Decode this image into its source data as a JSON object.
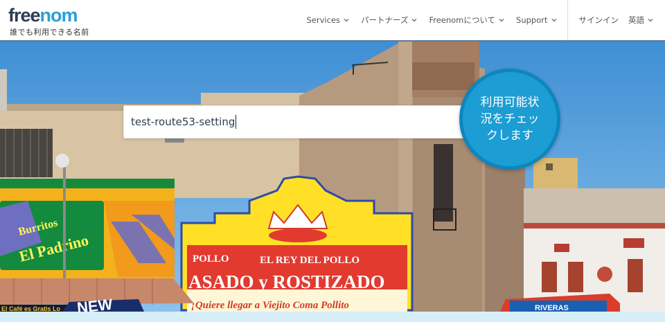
{
  "header": {
    "logo": {
      "word_part1": "free",
      "word_part2": "nom",
      "tagline": "誰でも利用できる名前"
    },
    "nav": {
      "services": "Services",
      "partners": "パートナーズ",
      "about": "Freenomについて",
      "support": "Support",
      "signin": "サインイン",
      "language": "英語"
    }
  },
  "hero": {
    "search": {
      "value": "test-route53-setting"
    },
    "check_button": "利用可能状況をチェックします",
    "signs": {
      "burritos": "Burritos",
      "el_padrino": "El Padrino",
      "pollo": "POLLO",
      "el_rey": "EL REY DEL POLLO",
      "asado": "ASADO y ROSTIZADO",
      "quiere": "¡Quiere llegar a Viejito Coma Pollito",
      "riveras": "RIVERAS",
      "new": "NEW",
      "cafe": "El Café es Gratis Lo"
    }
  },
  "colors": {
    "brand_dark": "#2a3c52",
    "brand_blue": "#2a9fd8",
    "check_button": "#1c9dd3",
    "header_border": "#5f7a96"
  }
}
